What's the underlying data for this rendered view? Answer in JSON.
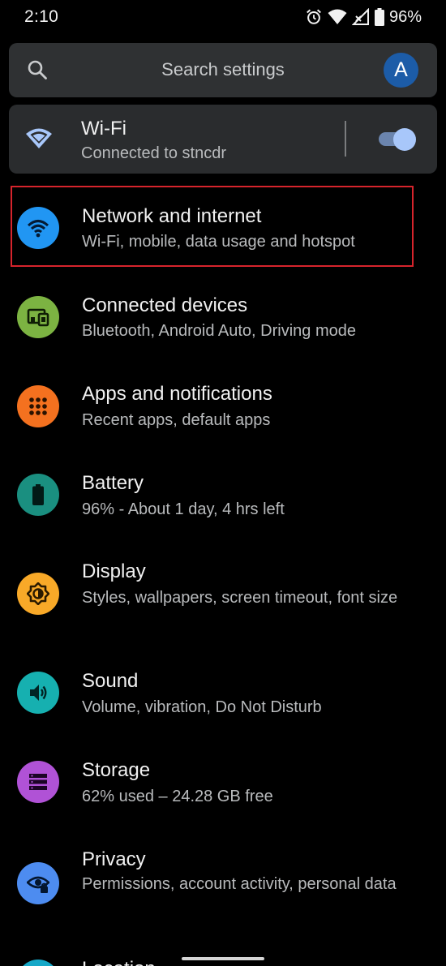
{
  "status_bar": {
    "time": "2:10",
    "battery_percent": "96%"
  },
  "search": {
    "placeholder": "Search settings",
    "avatar_letter": "A"
  },
  "wifi_card": {
    "title": "Wi-Fi",
    "subtitle": "Connected to stncdr",
    "toggle_on": true
  },
  "items": [
    {
      "title": "Network and internet",
      "subtitle": "Wi-Fi, mobile, data usage and hotspot",
      "icon": "wifi-icon",
      "color": "#2196f3",
      "highlighted": true
    },
    {
      "title": "Connected devices",
      "subtitle": "Bluetooth, Android Auto, Driving mode",
      "icon": "devices-icon",
      "color": "#7cb342"
    },
    {
      "title": "Apps and notifications",
      "subtitle": "Recent apps, default apps",
      "icon": "apps-grid-icon",
      "color": "#f4711f"
    },
    {
      "title": "Battery",
      "subtitle": "96% - About 1 day, 4 hrs left",
      "icon": "battery-icon",
      "color": "#1a8f80"
    },
    {
      "title": "Display",
      "subtitle": "Styles, wallpapers, screen timeout, font size",
      "icon": "brightness-icon",
      "color": "#f8a928"
    },
    {
      "title": "Sound",
      "subtitle": "Volume, vibration, Do Not Disturb",
      "icon": "volume-icon",
      "color": "#16b0b0"
    },
    {
      "title": "Storage",
      "subtitle": "62% used – 24.28 GB free",
      "icon": "storage-icon",
      "color": "#b052d6"
    },
    {
      "title": "Privacy",
      "subtitle": "Permissions, account activity, personal data",
      "icon": "privacy-eye-icon",
      "color": "#4d8cf0"
    },
    {
      "title": "Location",
      "subtitle": "",
      "icon": "location-icon",
      "color": "#16a8c8"
    }
  ]
}
